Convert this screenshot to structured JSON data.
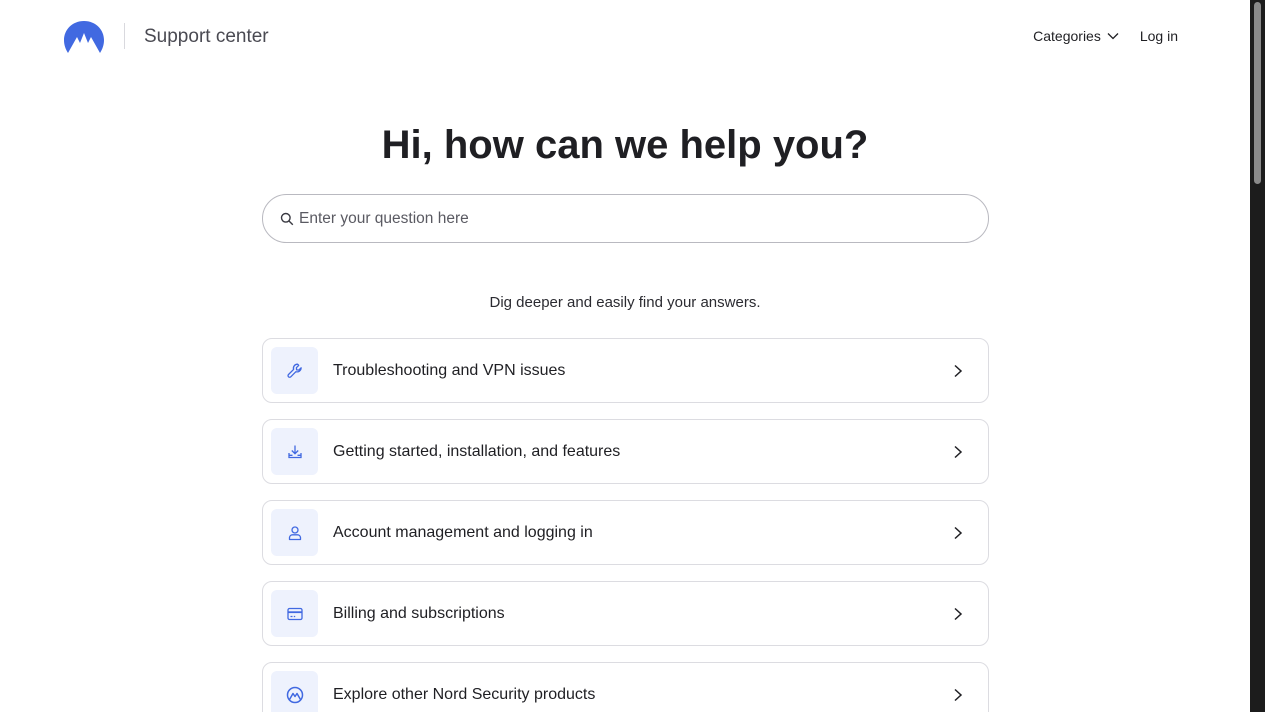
{
  "header": {
    "logo_name": "nord-logo-icon",
    "site_title": "Support center",
    "nav": {
      "categories_label": "Categories",
      "login_label": "Log in"
    }
  },
  "hero": {
    "title": "Hi, how can we help you?"
  },
  "search": {
    "placeholder": "Enter your question here",
    "value": ""
  },
  "subtitle": "Dig deeper and easily find your answers.",
  "categories": [
    {
      "label": "Troubleshooting and VPN issues",
      "icon": "wrench-icon"
    },
    {
      "label": "Getting started, installation, and features",
      "icon": "download-icon"
    },
    {
      "label": "Account management and logging in",
      "icon": "user-icon"
    },
    {
      "label": "Billing and subscriptions",
      "icon": "credit-card-icon"
    },
    {
      "label": "Explore other Nord Security products",
      "icon": "nord-products-icon"
    }
  ],
  "colors": {
    "brand": "#4169e1",
    "icon_bg": "#eef2fd",
    "text": "#1f1f23"
  }
}
